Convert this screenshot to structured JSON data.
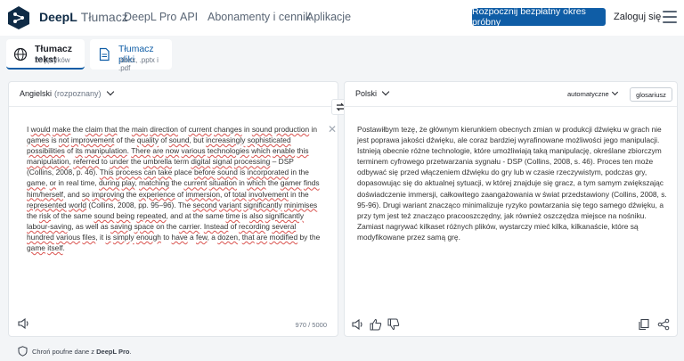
{
  "header": {
    "brand_bold": "DeepL",
    "brand_light": "Tłumacz",
    "nav": [
      "DeepL Pro",
      "API",
      "Abonamenty i cennik",
      "Aplikacje"
    ],
    "cta": "Rozpocznij bezpłatny okres próbny",
    "login": "Zaloguj się"
  },
  "modes": {
    "text": {
      "title": "Tłumacz tekst",
      "sub": "26 języków"
    },
    "files": {
      "title": "Tłumacz pliki",
      "sub": ".docx, .pptx i .pdf"
    }
  },
  "source": {
    "lang": "Angielski",
    "detected": "(rozpoznany)",
    "counter": "970 / 5000",
    "text_segments": [
      [
        "I ",
        false
      ],
      [
        "would",
        true
      ],
      [
        " ",
        false
      ],
      [
        "make",
        true
      ],
      [
        " the ",
        false
      ],
      [
        "claim",
        true
      ],
      [
        " ",
        false
      ],
      [
        "that",
        true
      ],
      [
        " the ",
        false
      ],
      [
        "main",
        true
      ],
      [
        " ",
        false
      ],
      [
        "direction",
        true
      ],
      [
        " of ",
        false
      ],
      [
        "current",
        true
      ],
      [
        " ",
        false
      ],
      [
        "changes",
        true
      ],
      [
        " in ",
        false
      ],
      [
        "sound",
        true
      ],
      [
        " ",
        false
      ],
      [
        "production",
        true
      ],
      [
        " in ",
        false
      ],
      [
        "games",
        true
      ],
      [
        " is ",
        false
      ],
      [
        "not",
        true
      ],
      [
        " ",
        false
      ],
      [
        "improvement",
        true
      ],
      [
        " of the ",
        false
      ],
      [
        "quality",
        true
      ],
      [
        " of ",
        false
      ],
      [
        "sound",
        true
      ],
      [
        ", but ",
        false
      ],
      [
        "increasingly",
        true
      ],
      [
        " ",
        false
      ],
      [
        "sophisticated",
        true
      ],
      [
        " ",
        false
      ],
      [
        "possibilities",
        true
      ],
      [
        " of ",
        false
      ],
      [
        "its",
        true
      ],
      [
        " ",
        false
      ],
      [
        "manipulation",
        true
      ],
      [
        ". ",
        false
      ],
      [
        "There",
        true
      ],
      [
        " ",
        false
      ],
      [
        "are",
        true
      ],
      [
        " ",
        false
      ],
      [
        "now",
        true
      ],
      [
        " ",
        false
      ],
      [
        "various",
        true
      ],
      [
        " ",
        false
      ],
      [
        "technologies",
        true
      ],
      [
        " ",
        false
      ],
      [
        "which",
        true
      ],
      [
        " ",
        false
      ],
      [
        "enable",
        true
      ],
      [
        " ",
        false
      ],
      [
        "this",
        true
      ],
      [
        " ",
        false
      ],
      [
        "manipulation",
        true
      ],
      [
        ", ",
        false
      ],
      [
        "referred",
        true
      ],
      [
        " to ",
        false
      ],
      [
        "under",
        true
      ],
      [
        " the ",
        false
      ],
      [
        "umbrella",
        true
      ],
      [
        " term ",
        false
      ],
      [
        "digital",
        true
      ],
      [
        " ",
        false
      ],
      [
        "signal",
        true
      ],
      [
        " ",
        false
      ],
      [
        "processing",
        true
      ],
      [
        " – DSP (Collins, 2008, p. 46). ",
        false
      ],
      [
        "This",
        true
      ],
      [
        " ",
        false
      ],
      [
        "process",
        true
      ],
      [
        " ",
        false
      ],
      [
        "can",
        true
      ],
      [
        " ",
        false
      ],
      [
        "take",
        true
      ],
      [
        " place ",
        false
      ],
      [
        "before",
        true
      ],
      [
        " ",
        false
      ],
      [
        "sound",
        true
      ],
      [
        " is ",
        false
      ],
      [
        "incorporated",
        true
      ],
      [
        " in the ",
        false
      ],
      [
        "game",
        true
      ],
      [
        ", ",
        false
      ],
      [
        "or",
        true
      ],
      [
        " in real time, ",
        false
      ],
      [
        "during",
        true
      ],
      [
        " ",
        false
      ],
      [
        "play",
        true
      ],
      [
        ", ",
        false
      ],
      [
        "matching",
        true
      ],
      [
        " the ",
        false
      ],
      [
        "current",
        true
      ],
      [
        " ",
        false
      ],
      [
        "situation",
        true
      ],
      [
        " in ",
        false
      ],
      [
        "which",
        true
      ],
      [
        " the ",
        false
      ],
      [
        "gamer",
        true
      ],
      [
        " ",
        false
      ],
      [
        "finds",
        true
      ],
      [
        " ",
        false
      ],
      [
        "him/",
        true
      ],
      [
        "herself",
        true
      ],
      [
        ", and ",
        false
      ],
      [
        "so",
        true
      ],
      [
        " ",
        false
      ],
      [
        "improving",
        true
      ],
      [
        " the ",
        false
      ],
      [
        "experience",
        true
      ],
      [
        " of ",
        false
      ],
      [
        "immersion",
        true
      ],
      [
        ", of ",
        false
      ],
      [
        "total",
        true
      ],
      [
        " ",
        false
      ],
      [
        "involvement",
        true
      ],
      [
        " in the ",
        false
      ],
      [
        "represented",
        true
      ],
      [
        " ",
        false
      ],
      [
        "world",
        true
      ],
      [
        " (Collins, 2008, pp. 95–96). The ",
        false
      ],
      [
        "second",
        true
      ],
      [
        " ",
        false
      ],
      [
        "variant",
        true
      ],
      [
        " ",
        false
      ],
      [
        "significantly",
        true
      ],
      [
        " ",
        false
      ],
      [
        "minimises",
        true
      ],
      [
        " the ",
        false
      ],
      [
        "risk",
        true
      ],
      [
        " of the same ",
        false
      ],
      [
        "sound",
        true
      ],
      [
        " ",
        false
      ],
      [
        "being",
        true
      ],
      [
        " ",
        false
      ],
      [
        "repeated",
        true
      ],
      [
        ", and at the same ",
        false
      ],
      [
        "time",
        true
      ],
      [
        " is ",
        false
      ],
      [
        "also",
        true
      ],
      [
        " ",
        false
      ],
      [
        "significantly",
        true
      ],
      [
        " ",
        false
      ],
      [
        "labour-saving",
        true
      ],
      [
        ", as well as ",
        false
      ],
      [
        "saving",
        true
      ],
      [
        " ",
        false
      ],
      [
        "space",
        true
      ],
      [
        " on the ",
        false
      ],
      [
        "carrier",
        true
      ],
      [
        ". ",
        false
      ],
      [
        "Instead",
        true
      ],
      [
        " of ",
        false
      ],
      [
        "recording",
        true
      ],
      [
        " ",
        false
      ],
      [
        "several",
        true
      ],
      [
        " ",
        false
      ],
      [
        "hundred",
        true
      ],
      [
        " ",
        false
      ],
      [
        "various",
        true
      ],
      [
        " ",
        false
      ],
      [
        "files",
        true
      ],
      [
        ", it ",
        false
      ],
      [
        "is",
        true
      ],
      [
        " ",
        false
      ],
      [
        "simply",
        true
      ],
      [
        " ",
        false
      ],
      [
        "enough",
        true
      ],
      [
        " to ",
        false
      ],
      [
        "have",
        true
      ],
      [
        " a ",
        false
      ],
      [
        "few",
        true
      ],
      [
        ", a ",
        false
      ],
      [
        "dozen",
        true
      ],
      [
        ", ",
        false
      ],
      [
        "that",
        true
      ],
      [
        " ",
        false
      ],
      [
        "are",
        true
      ],
      [
        " ",
        false
      ],
      [
        "modified",
        true
      ],
      [
        " by the ",
        false
      ],
      [
        "game",
        true
      ],
      [
        " ",
        false
      ],
      [
        "itself",
        true
      ],
      [
        ".",
        false
      ]
    ]
  },
  "target": {
    "lang": "Polski",
    "formality": "automatyczne",
    "glossary": "glosariusz",
    "text": "Postawiłbym tezę, że głównym kierunkiem obecnych zmian w produkcji dźwięku w grach nie jest poprawa jakości dźwięku, ale coraz bardziej wyrafinowane możliwości jego manipulacji. Istnieją obecnie różne technologie, które umożliwiają taką manipulację, określane zbiorczym terminem cyfrowego przetwarzania sygnału - DSP (Collins, 2008, s. 46). Proces ten może odbywać się przed włączeniem dźwięku do gry lub w czasie rzeczywistym, podczas gry, dopasowując się do aktualnej sytuacji, w której znajduje się gracz, a tym samym zwiększając doświadczenie immersji, całkowitego zaangażowania w świat przedstawiony (Collins, 2008, s. 95-96). Drugi wariant znacząco minimalizuje ryzyko powtarzania się tego samego dźwięku, a przy tym jest też znacząco pracooszczędny, jak również oszczędza miejsce na nośniku. Zamiast nagrywać kilkaset różnych plików, wystarczy mieć kilka, kilkanaście, które są modyfikowane przez samą grę."
  },
  "footer": {
    "text_pre": "Chroń poufne dane z ",
    "text_link": "DeepL Pro",
    "text_post": "."
  },
  "colors": {
    "accent": "#0f5da6",
    "brand_dark": "#0f2b46"
  }
}
